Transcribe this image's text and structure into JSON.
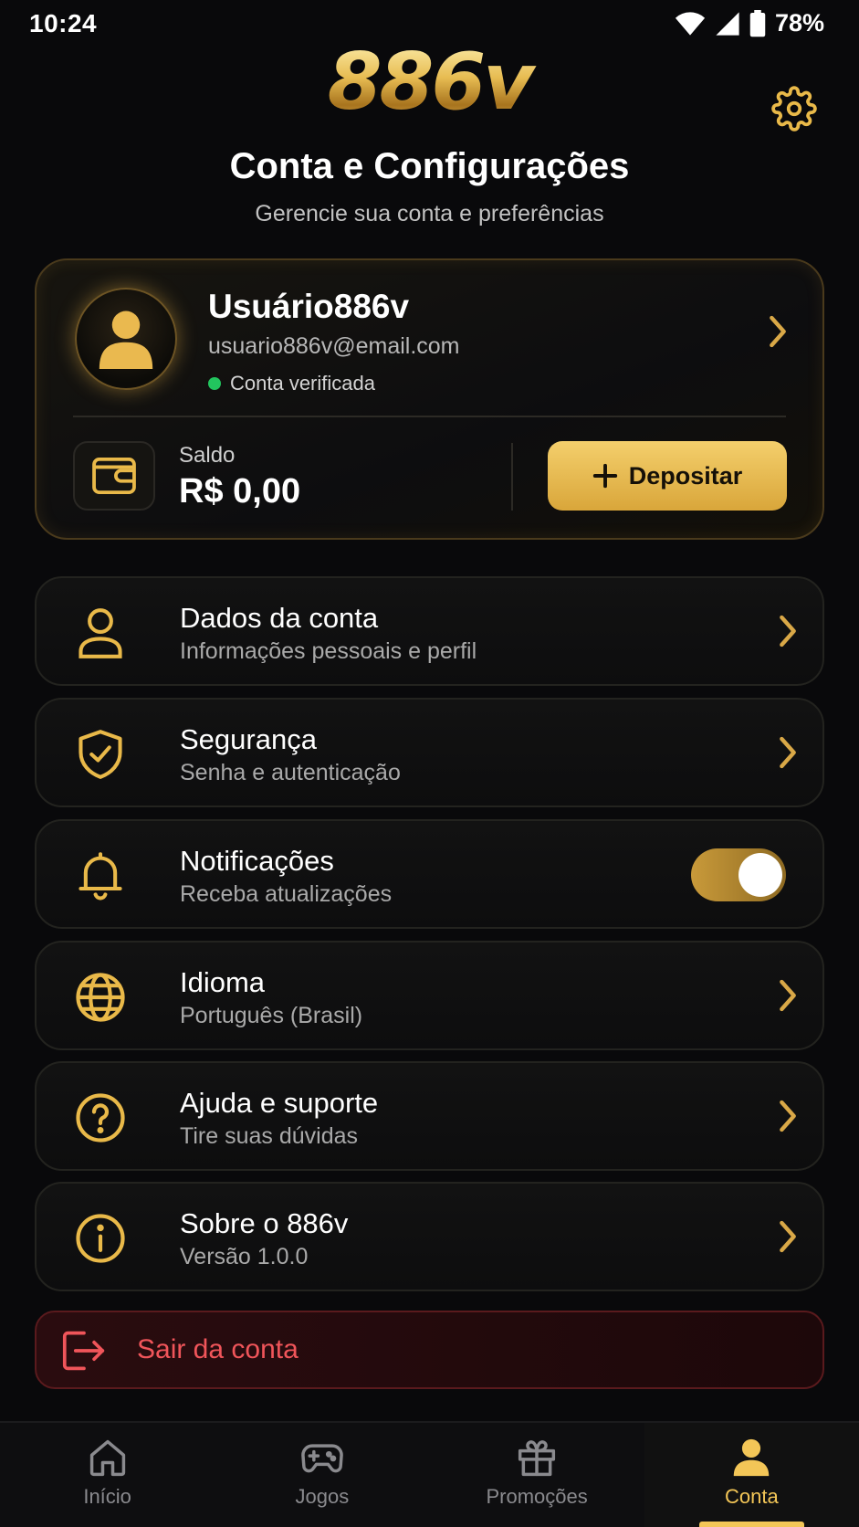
{
  "status_bar": {
    "time": "10:24",
    "battery": "78%"
  },
  "header": {
    "logo": "886v",
    "title": "Conta e Configurações",
    "subtitle": "Gerencie sua conta e preferências",
    "settings_icon": "gear-icon"
  },
  "profile": {
    "username": "Usuário886v",
    "email": "usuario886v@email.com",
    "status": "Conta verificada",
    "status_color": "#22c55e",
    "balance_label": "Saldo",
    "balance_value": "R$ 0,00",
    "deposit_label": "Depositar"
  },
  "menu": [
    {
      "title": "Dados da conta",
      "subtitle": "Informações pessoais e perfil",
      "icon": "user-icon"
    },
    {
      "title": "Segurança",
      "subtitle": "Senha e autenticação",
      "icon": "shield-check-icon"
    },
    {
      "title": "Notificações",
      "subtitle": "Receba atualizações",
      "icon": "bell-icon",
      "toggle_on": true
    },
    {
      "title": "Idioma",
      "subtitle": "Português (Brasil)",
      "icon": "globe-icon"
    },
    {
      "title": "Ajuda e suporte",
      "subtitle": "Tire suas dúvidas",
      "icon": "help-circle-icon"
    },
    {
      "title": "Sobre o 886v",
      "subtitle": "Versão 1.0.0",
      "icon": "info-icon"
    }
  ],
  "logout": {
    "label": "Sair da conta",
    "color": "#f0555a"
  },
  "nav": [
    {
      "label": "Início",
      "icon": "home-icon"
    },
    {
      "label": "Jogos",
      "icon": "gamepad-icon"
    },
    {
      "label": "Promoções",
      "icon": "gift-icon"
    },
    {
      "label": "Conta",
      "icon": "user-icon",
      "active": true
    }
  ],
  "colors": {
    "accent": "#e9b949",
    "background": "#09090b",
    "danger": "#f0555a"
  }
}
